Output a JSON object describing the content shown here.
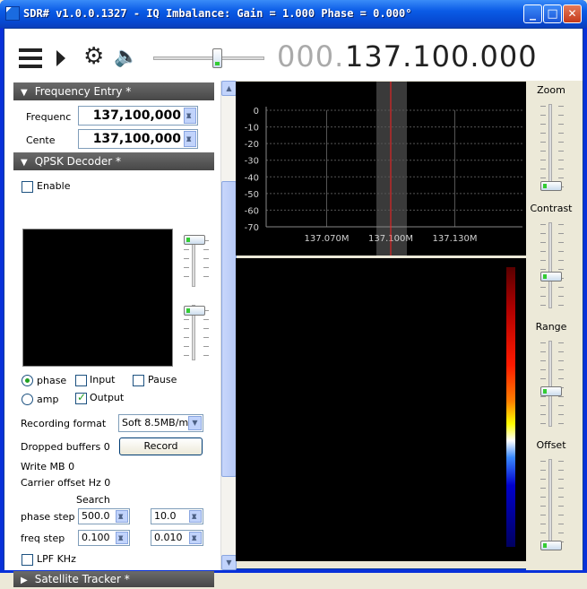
{
  "window": {
    "title": "SDR# v1.0.0.1327 - IQ Imbalance: Gain = 1.000 Phase = 0.000°",
    "minimize": "_",
    "maximize": "□",
    "close": "✕"
  },
  "toolbar": {
    "menu_icon": "menu-icon",
    "play_icon": "play-icon",
    "settings_icon": "gear-icon",
    "audio_icon": "speaker-icon",
    "gear_glyph": "⚙",
    "speaker_glyph": "🔈",
    "volume_level": 0.6,
    "freq_leading": "000.",
    "freq_value": "137.100.000"
  },
  "freq_entry": {
    "header": "Frequency Entry *",
    "freq_label": "Frequenc",
    "freq_value": "137,100,000",
    "center_label": "Cente",
    "center_value": "137,100,000"
  },
  "qpsk": {
    "header": "QPSK Decoder *",
    "enable_label": "Enable",
    "enable": false,
    "phase_label": "phase",
    "amp_label": "amp",
    "mode": "phase",
    "input_label": "Input",
    "input": false,
    "output_label": "Output",
    "output": true,
    "pause_label": "Pause",
    "pause": false,
    "rec_format_label": "Recording format",
    "rec_format_value": "Soft 8.5MB/m",
    "dropped_label": "Dropped buffers 0",
    "record_button": "Record",
    "write_label": "Write MB 0",
    "carrier_label": "Carrier offset Hz 0",
    "search_label": "Search",
    "phase_step_label": "phase step",
    "phase_step_value": "500.0",
    "phase_search_value": "10.0",
    "freq_step_label": "freq step",
    "freq_step_value": "0.100",
    "freq_search_value": "0.010",
    "lpf_label": "LPF KHz"
  },
  "satellite": {
    "header": "Satellite Tracker *"
  },
  "spectrum": {
    "y_labels": [
      "0",
      "-10",
      "-20",
      "-30",
      "-40",
      "-50",
      "-60",
      "-70"
    ],
    "x_labels": [
      "137.070M",
      "137.100M",
      "137.130M"
    ],
    "colors": {
      "grid": "#555555",
      "marker": "#ff2020",
      "band": "#3a3a3a",
      "axis_text": "#d0d0d0"
    }
  },
  "right": {
    "zoom": "Zoom",
    "contrast": "Contrast",
    "range": "Range",
    "offset": "Offset"
  }
}
